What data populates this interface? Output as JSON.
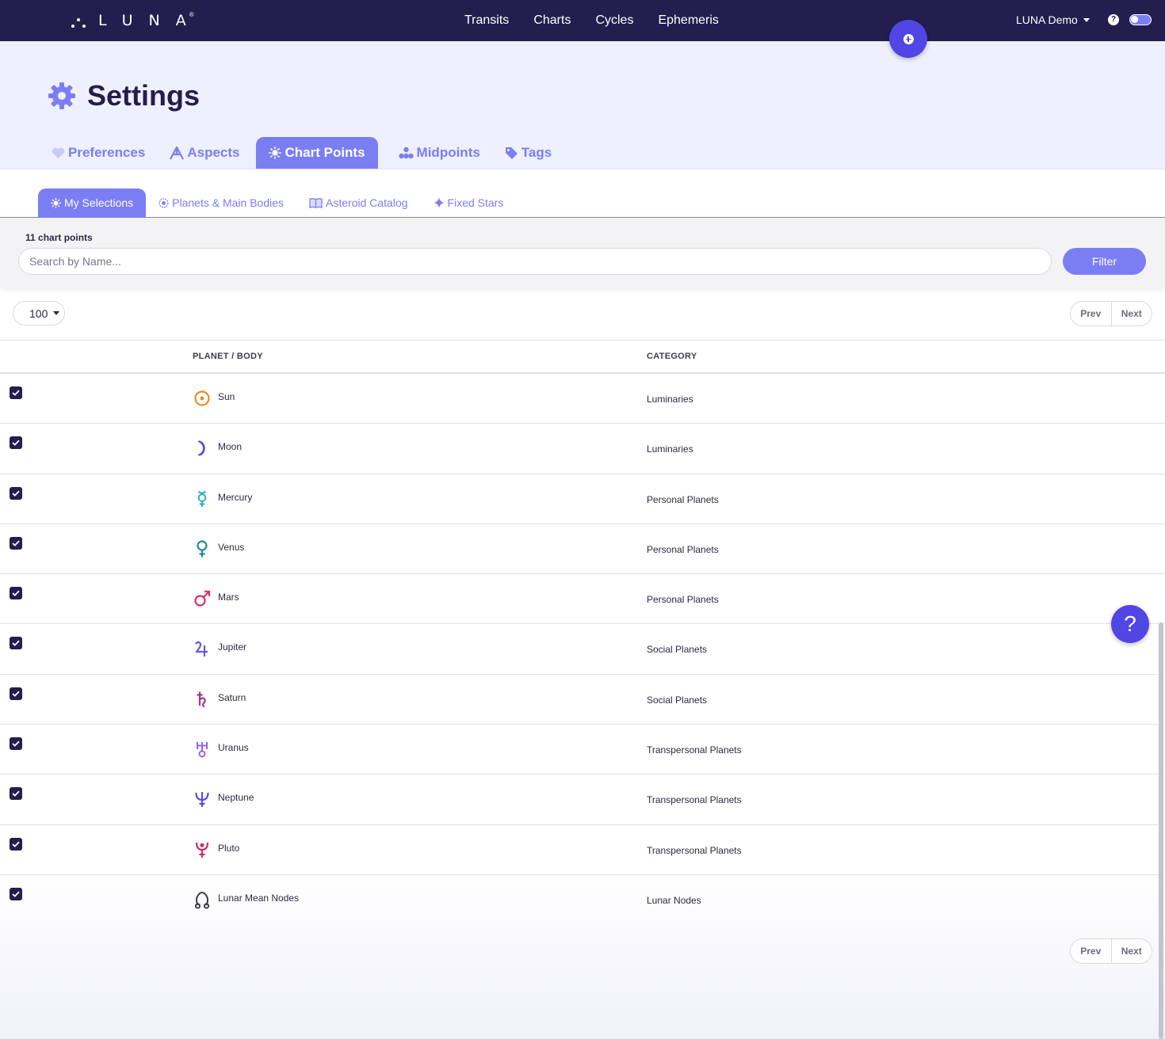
{
  "nav": {
    "logo_text": "LUNA",
    "logo_mark": "®",
    "links": [
      "Transits",
      "Charts",
      "Cycles",
      "Ephemeris"
    ],
    "user_label": "LUNA Demo",
    "help_glyph": "?"
  },
  "page": {
    "title": "Settings",
    "title_icon": "gear-icon"
  },
  "main_tabs": [
    {
      "label": "Preferences",
      "icon": "heart-icon",
      "active": false
    },
    {
      "label": "Aspects",
      "icon": "aspects-icon",
      "active": false
    },
    {
      "label": "Chart Points",
      "icon": "sun-burst-icon",
      "active": true
    },
    {
      "label": "Midpoints",
      "icon": "midpoints-icon",
      "active": false
    },
    {
      "label": "Tags",
      "icon": "tag-icon",
      "active": false
    }
  ],
  "sub_tabs": [
    {
      "label": "My Selections",
      "icon": "sun-burst-icon",
      "active": true
    },
    {
      "label": "Planets & Main Bodies",
      "icon": "target-icon",
      "active": false
    },
    {
      "label": "Asteroid Catalog",
      "icon": "book-icon",
      "active": false
    },
    {
      "label": "Fixed Stars",
      "icon": "star-icon",
      "active": false
    }
  ],
  "search": {
    "count_label": "11 chart points",
    "placeholder": "Search by Name...",
    "value": "",
    "filter_label": "Filter"
  },
  "pagination": {
    "per_page": "100",
    "prev_label": "Prev",
    "next_label": "Next"
  },
  "table": {
    "columns": [
      "PLANET / BODY",
      "CATEGORY"
    ],
    "rows": [
      {
        "checked": true,
        "name": "Sun",
        "category": "Luminaries",
        "icon": "sun-icon",
        "color": "#ea8a25"
      },
      {
        "checked": true,
        "name": "Moon",
        "category": "Luminaries",
        "icon": "moon-icon",
        "color": "#5a52d8"
      },
      {
        "checked": true,
        "name": "Mercury",
        "category": "Personal Planets",
        "icon": "mercury-icon",
        "color": "#2ab1c4"
      },
      {
        "checked": true,
        "name": "Venus",
        "category": "Personal Planets",
        "icon": "venus-icon",
        "color": "#1f8c99"
      },
      {
        "checked": true,
        "name": "Mars",
        "category": "Personal Planets",
        "icon": "mars-icon",
        "color": "#db2f6c"
      },
      {
        "checked": true,
        "name": "Jupiter",
        "category": "Social Planets",
        "icon": "jupiter-icon",
        "color": "#6759e0"
      },
      {
        "checked": true,
        "name": "Saturn",
        "category": "Social Planets",
        "icon": "saturn-icon",
        "color": "#9a3f86"
      },
      {
        "checked": true,
        "name": "Uranus",
        "category": "Transpersonal Planets",
        "icon": "uranus-icon",
        "color": "#9a63e5"
      },
      {
        "checked": true,
        "name": "Neptune",
        "category": "Transpersonal Planets",
        "icon": "neptune-icon",
        "color": "#5a52d8"
      },
      {
        "checked": true,
        "name": "Pluto",
        "category": "Transpersonal Planets",
        "icon": "pluto-icon",
        "color": "#cc2f6c"
      },
      {
        "checked": true,
        "name": "Lunar Mean Nodes",
        "category": "Lunar Nodes",
        "icon": "lunar-node-icon",
        "color": "#3a3a4a"
      }
    ]
  },
  "help_fab": "?",
  "colors": {
    "nav_bg": "#241e4e",
    "accent": "#7b7ef3",
    "fab": "#4f46e5",
    "header_bg": "#eef0fd"
  }
}
